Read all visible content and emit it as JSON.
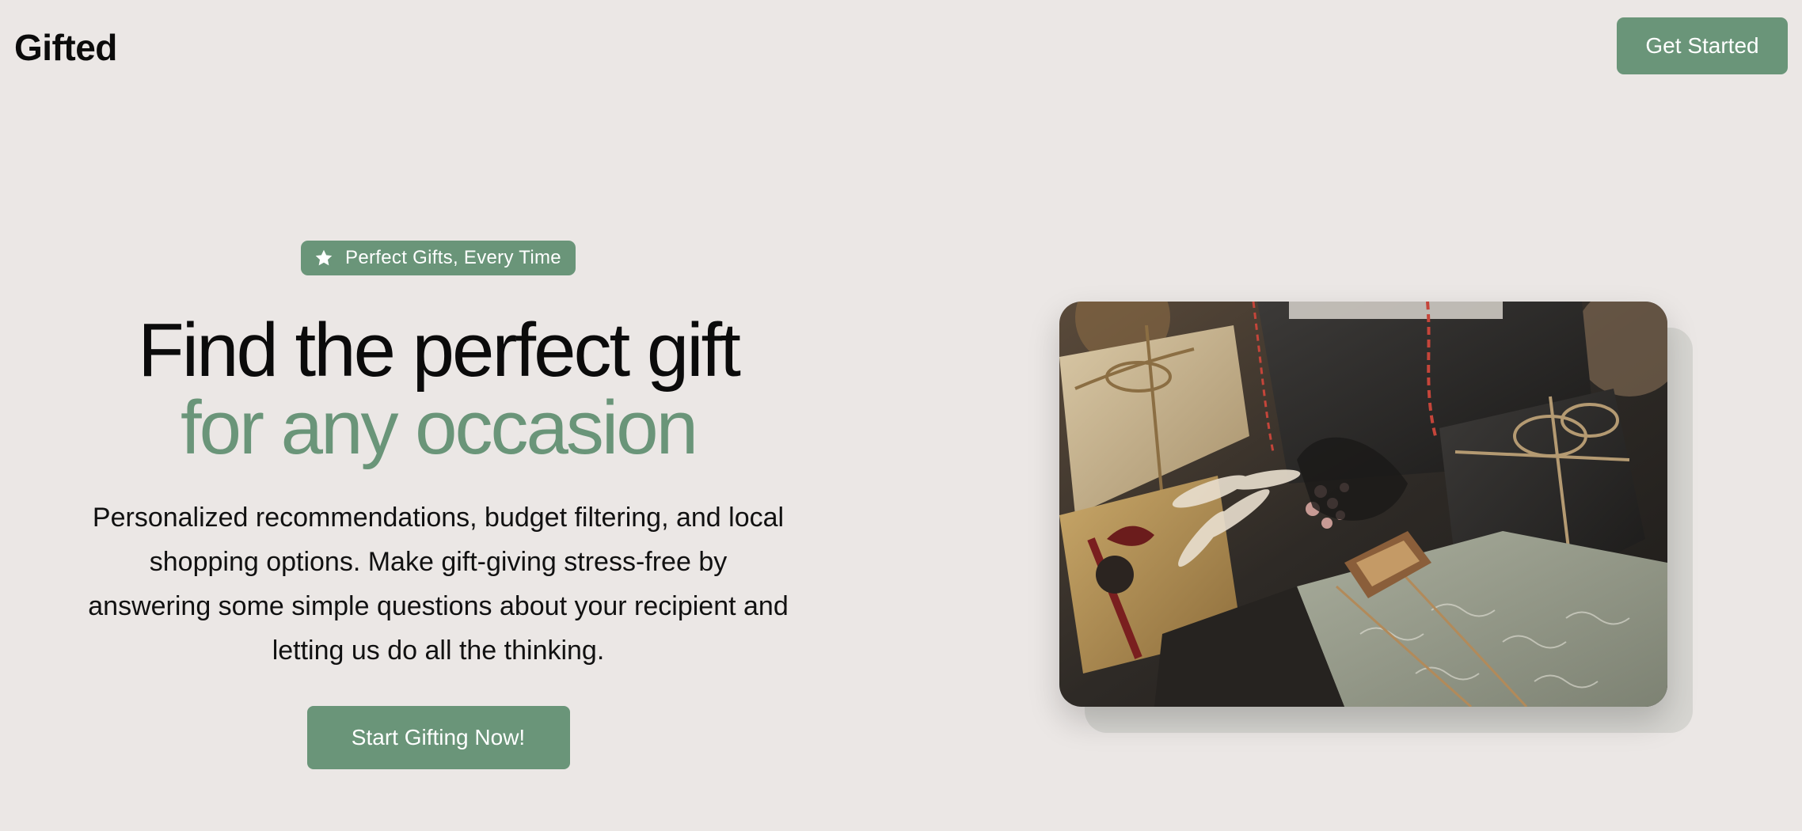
{
  "header": {
    "logo": "Gifted",
    "cta_label": "Get Started"
  },
  "hero": {
    "badge_icon": "star-icon",
    "badge_label": "Perfect Gifts, Every Time",
    "title_line1": "Find the perfect gift",
    "title_line2": "for any occasion",
    "description": "Personalized recommendations, budget filtering, and local shopping options. Make gift-giving stress-free by answering some simple questions about your recipient and letting us do all the thinking.",
    "cta_label": "Start Gifting Now!"
  },
  "colors": {
    "background": "#ebe7e5",
    "accent": "#6a9579",
    "text": "#0b0b0b"
  }
}
